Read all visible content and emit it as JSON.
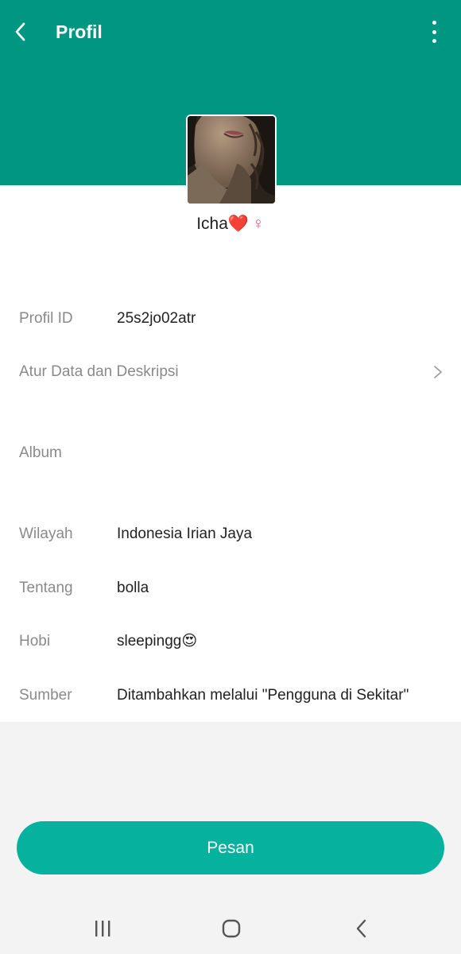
{
  "header": {
    "title": "Profil",
    "back_icon": "chevron-left-icon",
    "menu_icon": "more-vertical-icon",
    "background_color": "#009682"
  },
  "profile": {
    "name": "Icha❤️",
    "gender_symbol": "♀",
    "avatar": "profile-photo"
  },
  "details": {
    "profile_id_label": "Profil ID",
    "profile_id_value": "25s2jo02atr",
    "manage_label": "Atur Data dan Deskripsi",
    "album_label": "Album",
    "region_label": "Wilayah",
    "region_value": "Indonesia Irian Jaya",
    "about_label": "Tentang",
    "about_value": "bolla",
    "hobby_label": "Hobi",
    "hobby_value": "sleepingg😍",
    "source_label": "Sumber",
    "source_value": "Ditambahkan melalui \"Pengguna di Sekitar\""
  },
  "actions": {
    "message_button": "Pesan",
    "accent_color": "#06b29d"
  },
  "navbar": {
    "recent_icon": "recent-apps-icon",
    "home_icon": "home-icon",
    "back_icon": "back-icon"
  }
}
